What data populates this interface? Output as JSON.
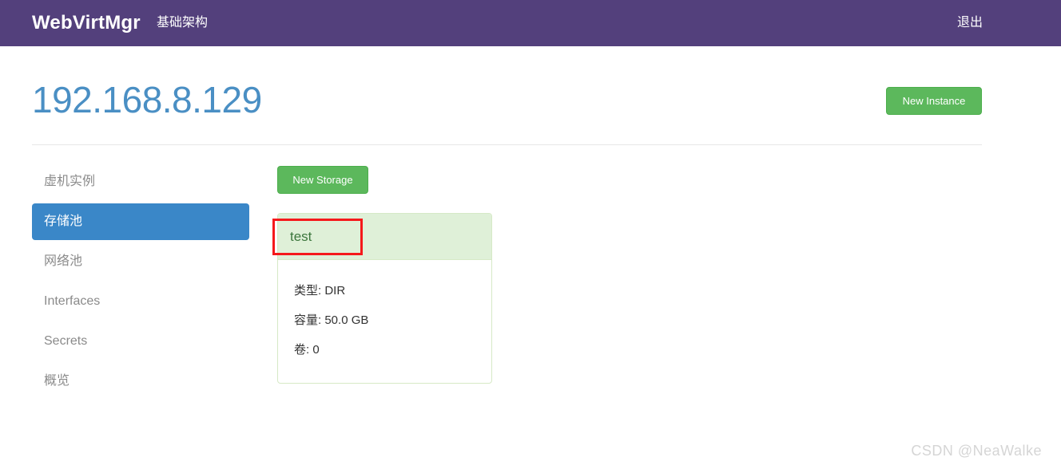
{
  "navbar": {
    "brand": "WebVirtMgr",
    "infrastructure_link": "基础架构",
    "logout_link": "退出",
    "background_color": "#53407c"
  },
  "header": {
    "title": "192.168.8.129",
    "title_color": "#4a8fc4",
    "new_instance_button": "New Instance",
    "new_instance_color": "#5cb85c"
  },
  "sidebar": {
    "items": [
      {
        "label": "虚机实例",
        "active": false
      },
      {
        "label": "存储池",
        "active": true
      },
      {
        "label": "网络池",
        "active": false
      },
      {
        "label": "Interfaces",
        "active": false
      },
      {
        "label": "Secrets",
        "active": false
      },
      {
        "label": "概览",
        "active": false
      }
    ],
    "active_color": "#3a87c8"
  },
  "content": {
    "new_storage_button": "New Storage",
    "new_storage_color": "#5cb85c",
    "storage_panel": {
      "name": "test",
      "heading_color": "#dff0d8",
      "title_color": "#3c763d",
      "rows": [
        {
          "label": "类型:",
          "value": "DIR"
        },
        {
          "label": "容量:",
          "value": "50.0 GB"
        },
        {
          "label": "卷:",
          "value": "0"
        }
      ]
    }
  },
  "annotation": {
    "color": "#f5191b"
  },
  "watermark": {
    "text": "CSDN @NeaWalke"
  }
}
